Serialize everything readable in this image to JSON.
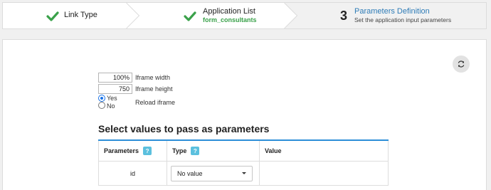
{
  "wizard": {
    "step1": {
      "title": "Link Type"
    },
    "step2": {
      "title": "Application List",
      "subtitle": "form_consultants"
    },
    "step3": {
      "number": "3",
      "title": "Parameters Definition",
      "subtitle": "Set the application input parameters"
    },
    "colors": {
      "done_check": "#3aa14a",
      "active_title": "#2e7cb7"
    }
  },
  "iframe": {
    "width_value": "100%",
    "width_label": "Iframe width",
    "height_value": "750",
    "height_label": "Iframe height",
    "reload_label": "Reload iframe",
    "reload_options": [
      "Yes",
      "No"
    ],
    "reload_selected": "Yes"
  },
  "params": {
    "section_title": "Select values to pass as parameters",
    "headers": {
      "parameters": "Parameters",
      "type": "Type",
      "value": "Value"
    },
    "help_glyph": "?",
    "rows": [
      {
        "name": "id",
        "type": "No value",
        "value": ""
      }
    ]
  },
  "icons": {
    "refresh": "refresh-icon",
    "check": "check-icon",
    "help": "help-icon"
  }
}
